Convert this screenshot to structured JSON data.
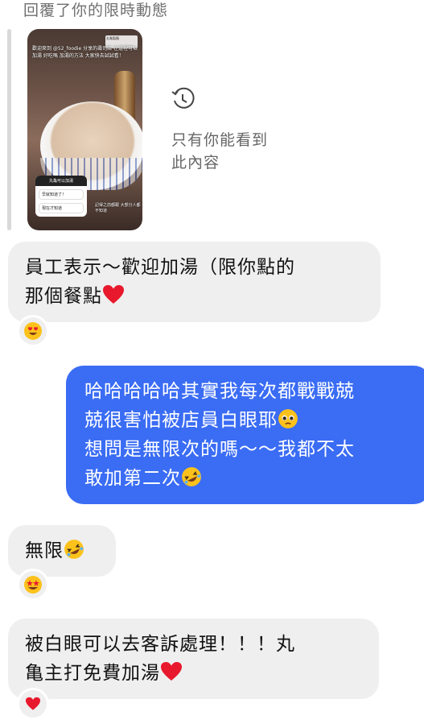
{
  "reply_label": "回覆了你的限時動態",
  "story": {
    "overlay_text": "歡迎來到 @52_foodie 分享的壽司店 在這裡可以加湯 好吃嗎 加湯的方法 大家快去試試看！",
    "brand": "丸亀製麵",
    "poll_title": "丸亀可以加湯",
    "poll_options": [
      "早就知道了！",
      "現在才知道"
    ],
    "caption": "記得之前都跟 大部分人都不知道"
  },
  "expired": {
    "line1": "只有你能看到",
    "line2": "此內容"
  },
  "messages": [
    {
      "direction": "in",
      "lines": [
        "員工表示～歡迎加湯（限你點的",
        "那個餐點"
      ],
      "end_emoji": "heart",
      "reaction": "heart-eyes"
    },
    {
      "direction": "out",
      "lines": [
        "哈哈哈哈哈其實我每次都戰戰兢",
        "兢很害怕被店員白眼耶",
        "想問是無限次的嗎～～我都不太",
        "敢加第二次"
      ]
    },
    {
      "direction": "in",
      "lines": [
        "無限"
      ],
      "end_emoji": "rofl",
      "reaction": "star-struck"
    },
    {
      "direction": "in",
      "lines": [
        "被白眼可以去客訴處理！！！丸",
        "亀主打免費加湯"
      ],
      "end_emoji": "heart",
      "reaction": "heart"
    }
  ],
  "colors": {
    "incoming_bubble": "#efefef",
    "outgoing_bubble": "#3a6cf4",
    "secondary_text": "#6f6f6f"
  }
}
